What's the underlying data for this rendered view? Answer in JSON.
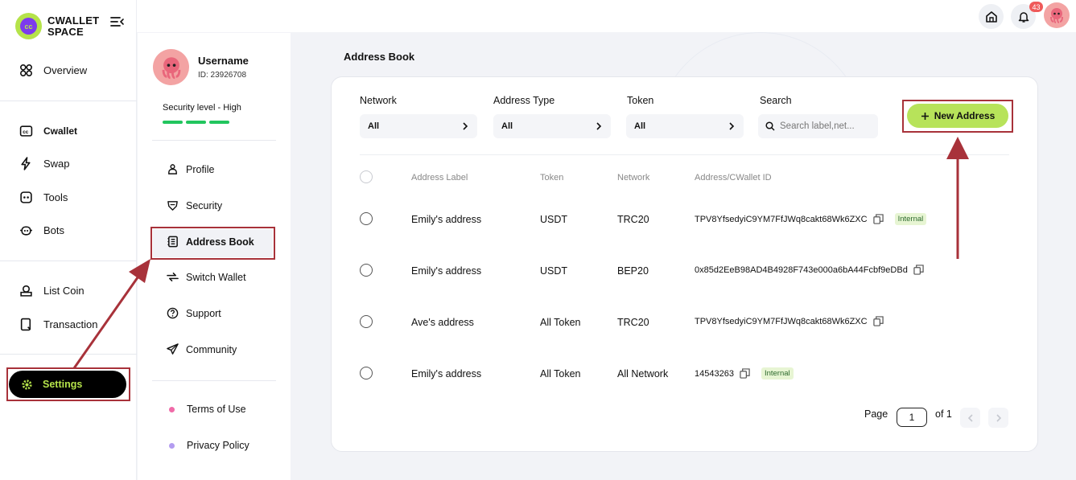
{
  "app": {
    "logo_text": "CWALLET SPACE",
    "logo_mark": "cc"
  },
  "sidebar": {
    "items": [
      {
        "label": "Overview",
        "icon": "apps-icon"
      },
      {
        "label": "Cwallet",
        "icon": "wallet-icon"
      },
      {
        "label": "Swap",
        "icon": "swap-icon"
      },
      {
        "label": "Tools",
        "icon": "tools-icon"
      },
      {
        "label": "Bots",
        "icon": "bot-icon"
      },
      {
        "label": "List Coin",
        "icon": "list-coin-icon"
      },
      {
        "label": "Transaction",
        "icon": "transaction-icon"
      }
    ],
    "settings_label": "Settings"
  },
  "topbar": {
    "notification_count": "43"
  },
  "profile": {
    "username": "Username",
    "id_text": "ID: 23926708",
    "security_level": "Security level - High",
    "security_bars": 3
  },
  "settings_menu": {
    "items": [
      {
        "label": "Profile",
        "icon": "user-icon"
      },
      {
        "label": "Security",
        "icon": "shield-icon"
      },
      {
        "label": "Address Book",
        "icon": "address-book-icon",
        "active": true
      },
      {
        "label": "Switch Wallet",
        "icon": "switch-icon"
      },
      {
        "label": "Support",
        "icon": "help-icon"
      },
      {
        "label": "Community",
        "icon": "send-icon"
      }
    ],
    "links": [
      {
        "label": "Terms of Use",
        "dot_color": "#f06ba8"
      },
      {
        "label": "Privacy Policy",
        "dot_color": "#b39cf0"
      }
    ]
  },
  "main": {
    "title": "Address Book",
    "filters": {
      "network_label": "Network",
      "network_value": "All",
      "address_type_label": "Address Type",
      "address_type_value": "All",
      "token_label": "Token",
      "token_value": "All",
      "search_label": "Search",
      "search_placeholder": "Search label,net..."
    },
    "new_address_label": "New Address",
    "columns": [
      "Address Label",
      "Token",
      "Network",
      "Address/CWallet ID"
    ],
    "rows": [
      {
        "label": "Emily's address",
        "token": "USDT",
        "network": "TRC20",
        "address": "TPV8YfsedyiC9YM7FfJWq8cakt68Wk6ZXC",
        "tag": "Internal"
      },
      {
        "label": "Emily's address",
        "token": "USDT",
        "network": "BEP20",
        "address": "0x85d2EeB98AD4B4928F743e000a6bA44Fcbf9eDBd",
        "tag": ""
      },
      {
        "label": "Ave's address",
        "token": "All Token",
        "network": "TRC20",
        "address": "TPV8YfsedyiC9YM7FfJWq8cakt68Wk6ZXC",
        "tag": ""
      },
      {
        "label": "Emily's address",
        "token": "All Token",
        "network": "All Network",
        "address": "14543263",
        "tag": "Internal"
      }
    ],
    "pagination": {
      "page_label": "Page",
      "page_value": "1",
      "of_label": "of 1"
    }
  },
  "colors": {
    "accent": "#b7e35a",
    "highlight": "#a8323a",
    "security_bar": "#22c55e"
  }
}
